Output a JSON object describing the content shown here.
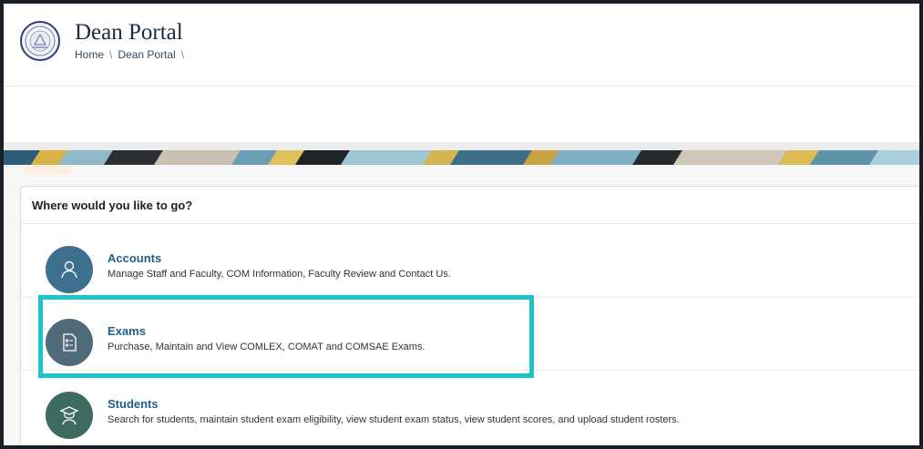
{
  "header": {
    "title": "Dean Portal",
    "breadcrumb": [
      "Home",
      "Dean Portal"
    ],
    "separator": "\\"
  },
  "card": {
    "heading": "Where would you like to go?",
    "items": [
      {
        "label": "Accounts",
        "description": "Manage Staff and Faculty, COM Information, Faculty Review and Contact Us.",
        "icon": "user-icon",
        "color": "#3d6f8e"
      },
      {
        "label": "Exams",
        "description": "Purchase, Maintain and View COMLEX, COMAT and COMSAE Exams.",
        "icon": "document-icon",
        "color": "#4f6a78"
      },
      {
        "label": "Students",
        "description": "Search for students, maintain student exam eligibility, view student exam status, view student scores, and upload student rosters.",
        "icon": "graduate-icon",
        "color": "#3d6b62"
      }
    ]
  },
  "colors": {
    "highlight": "#1fc2d1",
    "link": "#1f5f8b"
  }
}
